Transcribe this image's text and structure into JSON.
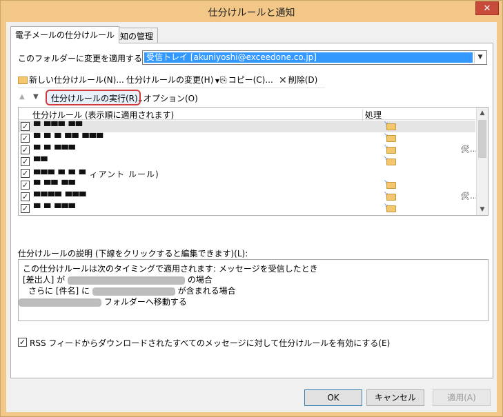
{
  "window": {
    "title": "仕分けルールと通知",
    "close_glyph": "✕"
  },
  "tabs": [
    {
      "label": "電子メールの仕分けルール"
    },
    {
      "label": "通知の管理"
    }
  ],
  "folder": {
    "label": "このフォルダーに変更を適用する(F):",
    "value": "受信トレイ [akuniyoshi@exceedone.co.jp]"
  },
  "toolbar": {
    "new_rule": "新しい仕分けルール(N)...",
    "change_rule": "仕分けルールの変更(H)",
    "copy": "コピー(C)...",
    "delete": "削除(D)",
    "run_rules": "仕分けルールの実行(R)...",
    "options": "オプション(O)"
  },
  "rules_list": {
    "col_name": "仕分けルール (表示順に適用されます)",
    "col_action": "処理",
    "rows": [
      {
        "name": "▀ ▀▀▀ ▀▀",
        "checked": true,
        "folder": true,
        "tool": false
      },
      {
        "name": "▀ ▀ ▀ ▀▀ ▀▀▀",
        "checked": true,
        "folder": true,
        "tool": false
      },
      {
        "name": "▀ ▀ ▀▀▀",
        "checked": true,
        "folder": true,
        "tool": true
      },
      {
        "name": "▀▀",
        "checked": true,
        "folder": true,
        "tool": false
      },
      {
        "name": "▀▀▀ ▀ ▀ ▀ ィアント ルール)",
        "checked": true,
        "folder": false,
        "tool": false
      },
      {
        "name": "▀ ▀▀ ▀▀",
        "checked": true,
        "folder": true,
        "tool": false
      },
      {
        "name": "▀▀▀▀ ▀▀▀",
        "checked": true,
        "folder": true,
        "tool": true
      },
      {
        "name": "▀ ▀ ▀▀▀",
        "checked": true,
        "folder": true,
        "tool": false
      }
    ]
  },
  "description": {
    "label": "仕分けルールの説明 (下線をクリックすると編集できます)(L):",
    "line1": "この仕分けルールは次のタイミングで適用されます: メッセージを受信したとき",
    "line2a": "[差出人] が",
    "line2b": "の場合",
    "line3a": "さらに [件名] に",
    "line3b": "が含まれる場合",
    "line4": "フォルダーへ移動する"
  },
  "rss": {
    "label": "RSS フィードからダウンロードされたすべてのメッセージに対して仕分けルールを有効にする(E)"
  },
  "buttons": {
    "ok": "OK",
    "cancel": "キャンセル",
    "apply": "適用(A)"
  }
}
